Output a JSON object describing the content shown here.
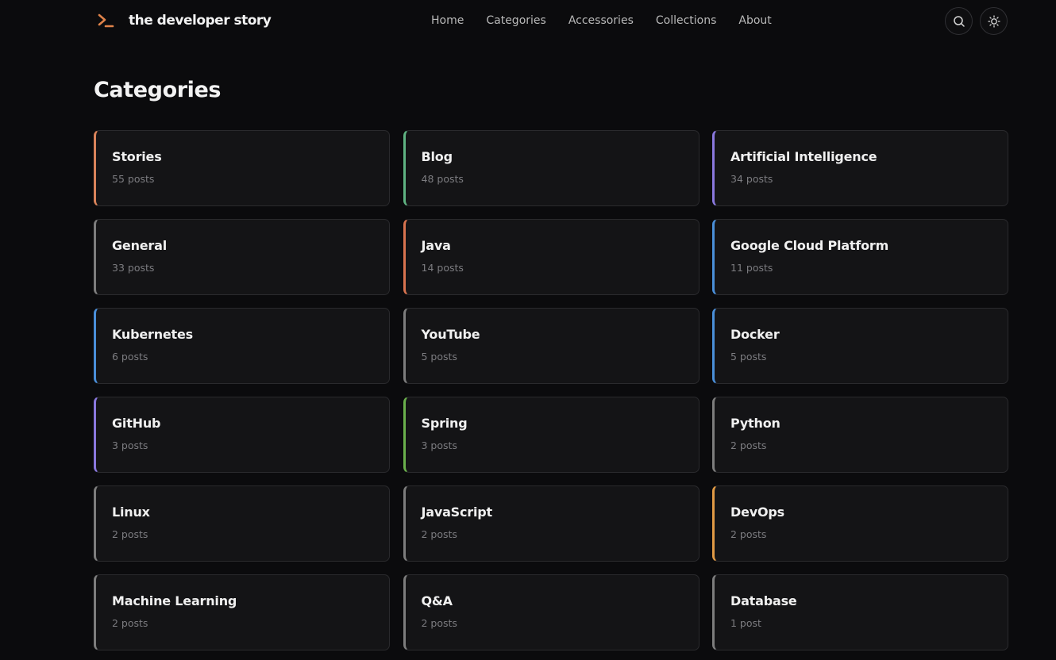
{
  "brand": {
    "name": "the developer story",
    "accent": "#e0834a"
  },
  "nav": [
    {
      "label": "Home"
    },
    {
      "label": "Categories"
    },
    {
      "label": "Accessories"
    },
    {
      "label": "Collections"
    },
    {
      "label": "About"
    }
  ],
  "actions": {
    "search_icon": "search-icon",
    "theme_icon": "sun-icon"
  },
  "page": {
    "title": "Categories"
  },
  "categories": [
    {
      "name": "Stories",
      "count": "55 posts",
      "color": "#d9835a"
    },
    {
      "name": "Blog",
      "count": "48 posts",
      "color": "#5fb382"
    },
    {
      "name": "Artificial Intelligence",
      "count": "34 posts",
      "color": "#8a78de"
    },
    {
      "name": "General",
      "count": "33 posts",
      "color": "#7d7d7d"
    },
    {
      "name": "Java",
      "count": "14 posts",
      "color": "#d8734f"
    },
    {
      "name": "Google Cloud Platform",
      "count": "11 posts",
      "color": "#4a8fd9"
    },
    {
      "name": "Kubernetes",
      "count": "6 posts",
      "color": "#4a8fd9"
    },
    {
      "name": "YouTube",
      "count": "5 posts",
      "color": "#7d7d7d"
    },
    {
      "name": "Docker",
      "count": "5 posts",
      "color": "#4a8fd9"
    },
    {
      "name": "GitHub",
      "count": "3 posts",
      "color": "#8a78de"
    },
    {
      "name": "Spring",
      "count": "3 posts",
      "color": "#6ab04c"
    },
    {
      "name": "Python",
      "count": "2 posts",
      "color": "#7d7d7d"
    },
    {
      "name": "Linux",
      "count": "2 posts",
      "color": "#7d7d7d"
    },
    {
      "name": "JavaScript",
      "count": "2 posts",
      "color": "#7d7d7d"
    },
    {
      "name": "DevOps",
      "count": "2 posts",
      "color": "#e09a45"
    },
    {
      "name": "Machine Learning",
      "count": "2 posts",
      "color": "#7d7d7d"
    },
    {
      "name": "Q&A",
      "count": "2 posts",
      "color": "#7d7d7d"
    },
    {
      "name": "Database",
      "count": "1 post",
      "color": "#7d7d7d"
    }
  ]
}
